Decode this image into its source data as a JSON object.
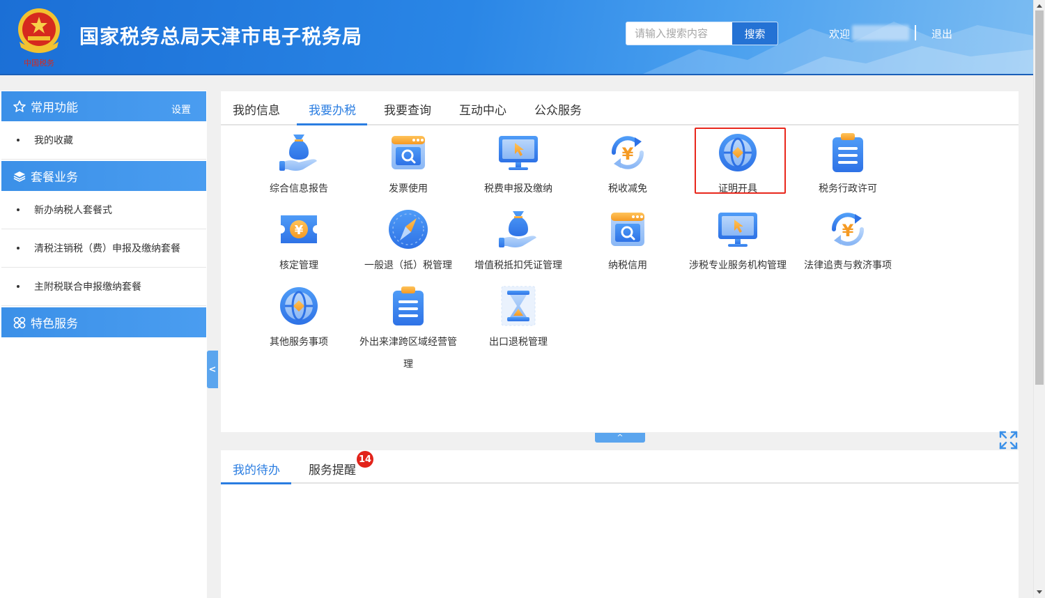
{
  "header": {
    "title": "国家税务总局天津市电子税务局",
    "search_placeholder": "请输入搜索内容",
    "search_button": "搜索",
    "welcome": "欢迎",
    "logout": "退出"
  },
  "sidebar": {
    "sections": [
      {
        "title": "常用功能",
        "extra": "设置",
        "icon": "star-icon",
        "items": [
          "我的收藏"
        ]
      },
      {
        "title": "套餐业务",
        "icon": "layers-icon",
        "items": [
          "新办纳税人套餐式",
          "清税注销税（费）申报及缴纳套餐",
          "主附税联合申报缴纳套餐"
        ]
      },
      {
        "title": "特色服务",
        "icon": "grid-icon",
        "items": []
      }
    ],
    "collapse_label": "<"
  },
  "main": {
    "tabs": [
      "我的信息",
      "我要办税",
      "我要查询",
      "互动中心",
      "公众服务"
    ],
    "active_tab": "我要办税",
    "items": [
      {
        "label": "综合信息报告",
        "icon": "money-hand-icon"
      },
      {
        "label": "发票使用",
        "icon": "invoice-search-icon"
      },
      {
        "label": "税费申报及缴纳",
        "icon": "monitor-cursor-icon"
      },
      {
        "label": "税收减免",
        "icon": "yuan-refresh-icon"
      },
      {
        "label": "证明开具",
        "icon": "globe-icon"
      },
      {
        "label": "税务行政许可",
        "icon": "clipboard-icon"
      },
      {
        "label": "核定管理",
        "icon": "yuan-ticket-icon"
      },
      {
        "label": "一般退（抵）税管理",
        "icon": "compass-icon"
      },
      {
        "label": "增值税抵扣凭证管理",
        "icon": "money-hand-icon"
      },
      {
        "label": "纳税信用",
        "icon": "invoice-search-icon"
      },
      {
        "label": "涉税专业服务机构管理",
        "icon": "monitor-cursor-icon"
      },
      {
        "label": "法律追责与救济事项",
        "icon": "yuan-refresh-icon"
      },
      {
        "label": "其他服务事项",
        "icon": "globe-icon"
      },
      {
        "label": "外出来津跨区域经营管理",
        "icon": "clipboard-icon"
      },
      {
        "label": "出口退税管理",
        "icon": "hourglass-icon"
      }
    ],
    "highlighted_item": "证明开具",
    "expand_label": "^"
  },
  "bottom": {
    "tabs": [
      "我的待办",
      "服务提醒"
    ],
    "active_tab": "我的待办",
    "badge_count": "14"
  },
  "colors": {
    "header_blue": "#2a86e6",
    "accent": "#2a7de1",
    "highlight_red": "#e8271c",
    "badge_red": "#e2231a"
  }
}
